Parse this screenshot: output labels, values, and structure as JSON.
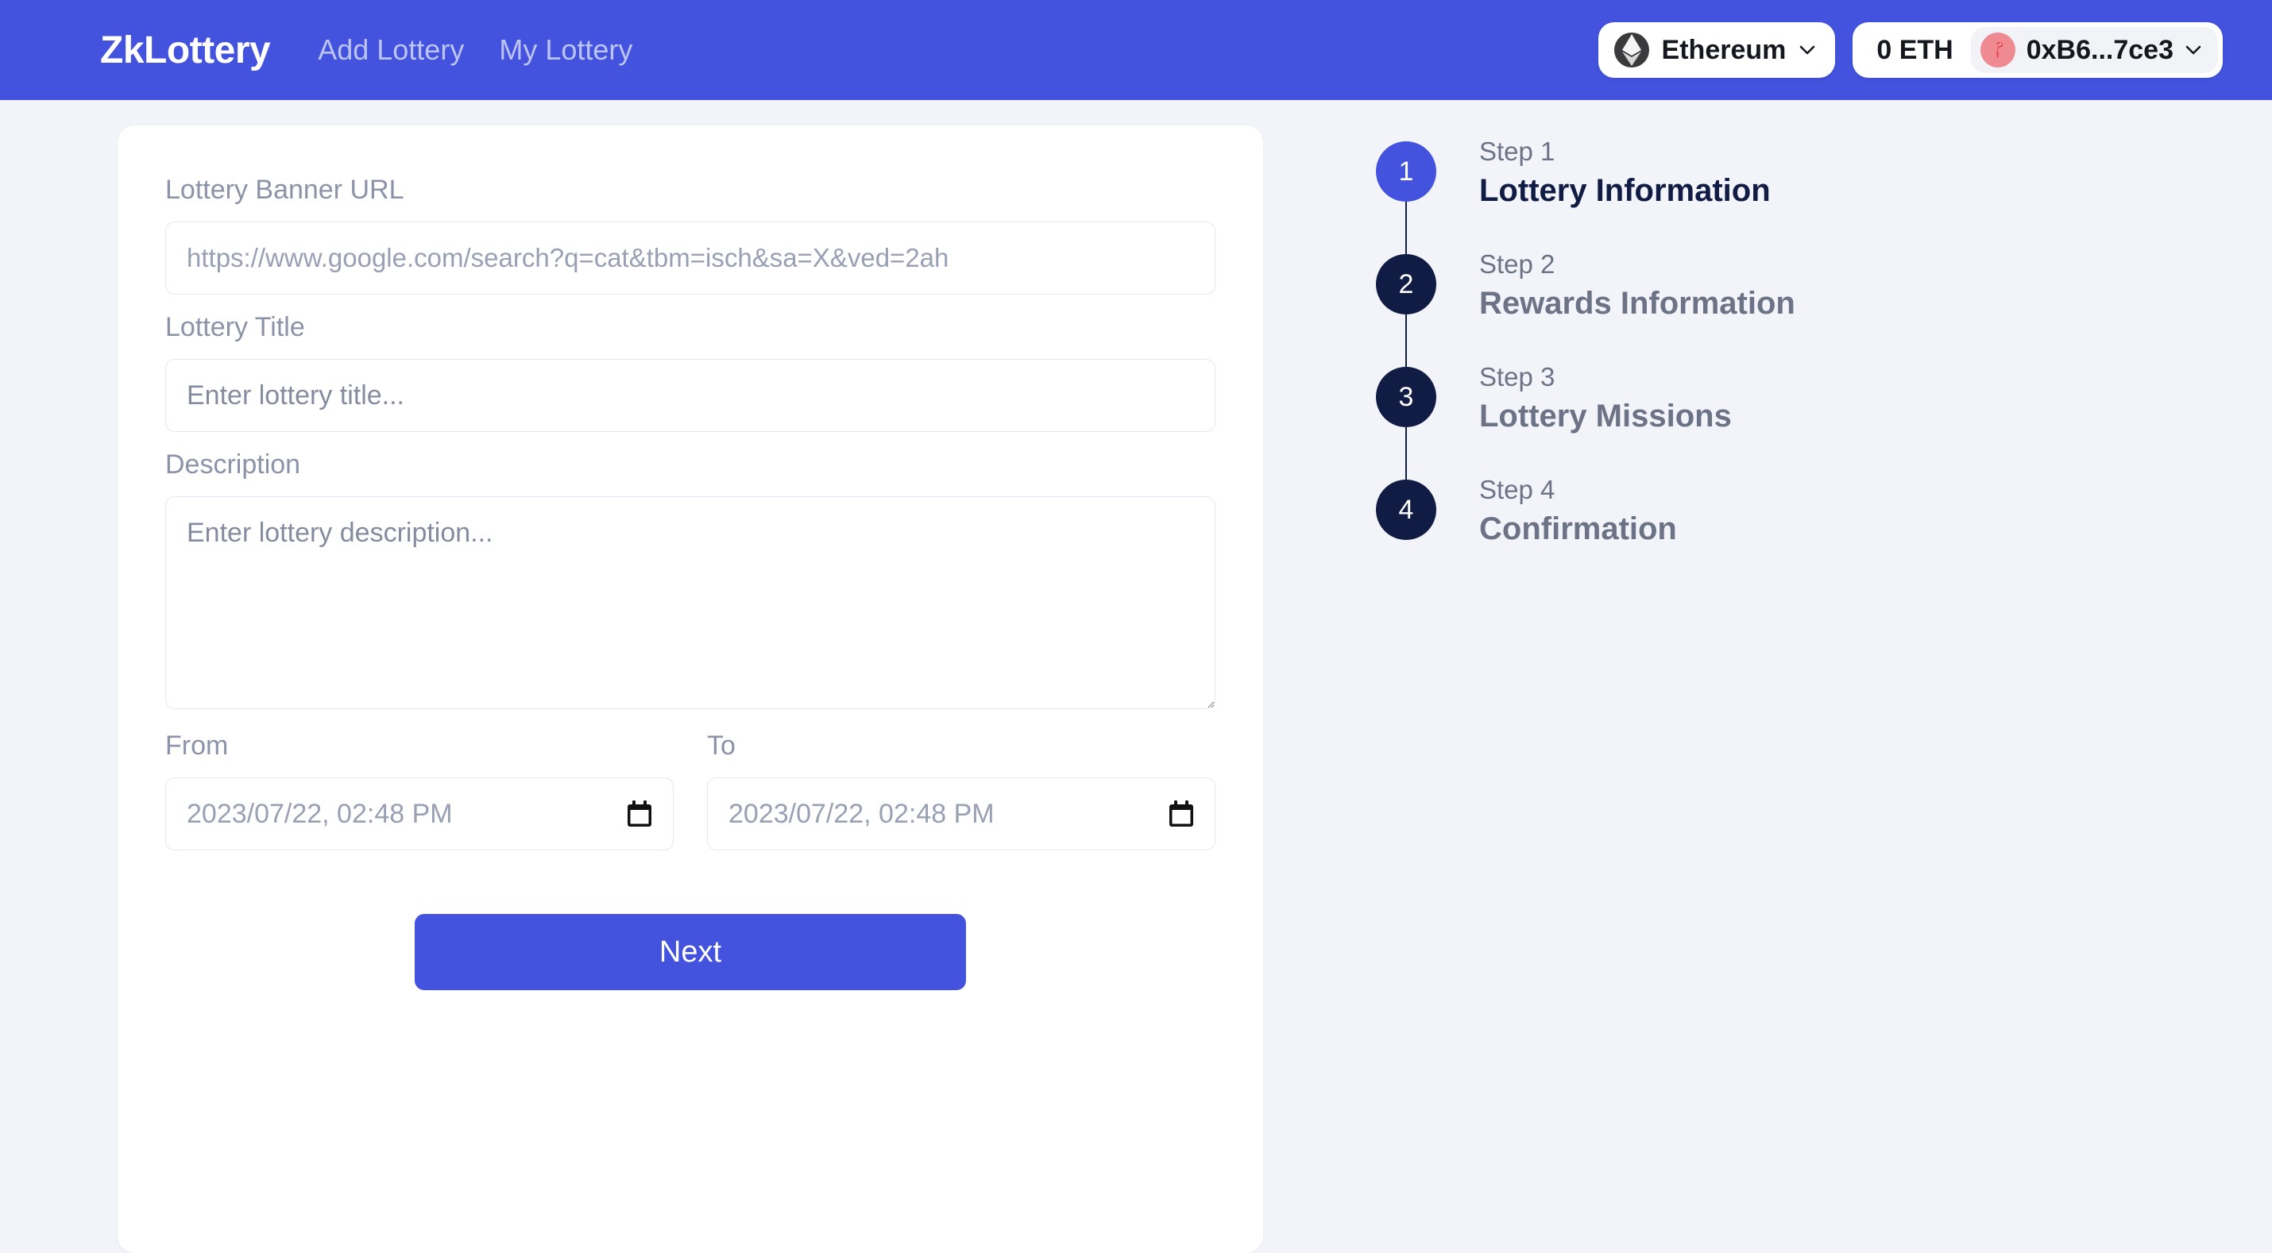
{
  "navbar": {
    "brand": "ZkLottery",
    "links": [
      {
        "label": "Add Lottery"
      },
      {
        "label": "My Lottery"
      }
    ],
    "chain": {
      "name": "Ethereum",
      "icon": "ethereum-icon",
      "chevron": "chevron-down-icon"
    },
    "account": {
      "balance": "0 ETH",
      "address": "0xB6...7ce3",
      "avatar": "flamingo-avatar",
      "chevron": "chevron-down-icon"
    },
    "colors": {
      "background": "#4353dd",
      "brand_text": "#ffffff",
      "link_text": "#bcc4f4"
    }
  },
  "form": {
    "banner_url": {
      "label": "Lottery Banner URL",
      "placeholder": "https://www.google.com/search?q=cat&tbm=isch&sa=X&ved=2ah",
      "value": ""
    },
    "title": {
      "label": "Lottery Title",
      "placeholder": "Enter lottery title...",
      "value": ""
    },
    "description": {
      "label": "Description",
      "placeholder": "Enter lottery description...",
      "value": ""
    },
    "from": {
      "label": "From",
      "value": "2023/07/22, 02:48 PM",
      "icon": "calendar-icon"
    },
    "to": {
      "label": "To",
      "value": "2023/07/22, 02:48 PM",
      "icon": "calendar-icon"
    },
    "submit": {
      "label": "Next"
    }
  },
  "stepper": {
    "steps": [
      {
        "number": "1",
        "kicker": "Step 1",
        "title": "Lottery Information",
        "active": true
      },
      {
        "number": "2",
        "kicker": "Step 2",
        "title": "Rewards Information",
        "active": false
      },
      {
        "number": "3",
        "kicker": "Step 3",
        "title": "Lottery Missions",
        "active": false
      },
      {
        "number": "4",
        "kicker": "Step 4",
        "title": "Confirmation",
        "active": false
      }
    ],
    "colors": {
      "active_bullet": "#4353dd",
      "inactive_bullet": "#101c43",
      "active_title": "#101c43",
      "inactive_title": "#6d7386"
    }
  }
}
